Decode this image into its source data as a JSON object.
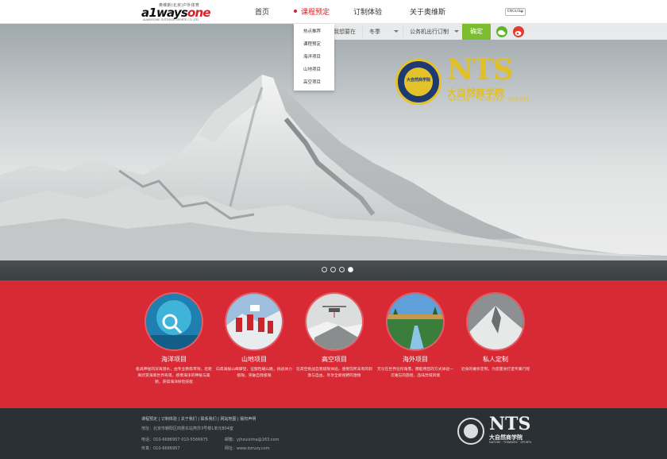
{
  "brand": {
    "logo_tagline": "奥维斯(北京)户外体育",
    "logo_word_a": "a1ways",
    "logo_word_b": "one",
    "logo_sub": "ALWAYSONE OUTDOOR SPORTS CO.,LTD"
  },
  "nav": {
    "items": [
      "首页",
      "课程预定",
      "订制体验",
      "关于奥维斯"
    ],
    "active_index": 1,
    "language": "ENGLISH"
  },
  "search": {
    "label": "我想要在",
    "season": "冬季",
    "type": "公务机出行订制",
    "confirm_label": "确定"
  },
  "dropdown": {
    "items": [
      "热点推荐",
      "课程预定",
      "海洋项目",
      "山地项目",
      "高空项目"
    ]
  },
  "hero": {
    "brand_title": "NTS",
    "brand_cn": "大自然商学院",
    "brand_en": "NATURE · THINKERS · SPORTS",
    "badge_text": "大自然商学院",
    "slide_count": 4,
    "active_slide": 3
  },
  "features": [
    {
      "title": "海洋项目",
      "desc": "极具神秘的深海潜水，由专业教练带领，近距离欣赏海底世界奇观，感受海洋的神秘与美丽，获得海洋探险技能"
    },
    {
      "title": "山地项目",
      "desc": "向高海拔山峰攀登，征服险峻山路，挑战体力极限，突破自我极限"
    },
    {
      "title": "高空项目",
      "desc": "在高空挑战自我极限体验，感受前所未有的刺激与自由，尽享全新视野的激情"
    },
    {
      "title": "海外项目",
      "desc": "无论在世界任何角落，都能用您的方式体验一次难忘的旅程，品味异域风情"
    },
    {
      "title": "私人定制",
      "desc": "近身的奢侈定制，为您量身打造专属行程"
    }
  ],
  "footer": {
    "links": "课程预定  |  订制体验  |  关于我们  |  联系我们  |  网站地图  |  版权声明",
    "address": "地址：北京市朝阳区四惠东站燕莎3号楼1单元804室",
    "phone": "电话：010-6686957  010-5566975",
    "fax": "传真：010-6686957",
    "email": "邮箱：yjhzuizima@163.com",
    "web": "网址：www.dzruzy.com",
    "logo_title": "NTS",
    "logo_cn": "大自然商学院",
    "logo_en": "NATURE · THINKERS · SPORTS"
  },
  "colors": {
    "brand_red": "#d82a35",
    "confirm_green": "#7bbd2f",
    "nts_gold": "#e1bf26",
    "footer_bg": "#2b3034"
  }
}
